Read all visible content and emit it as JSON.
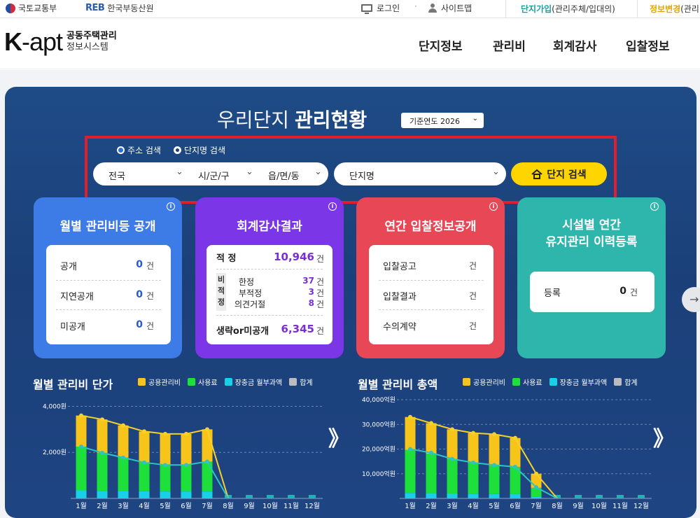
{
  "topbar": {
    "molit": "국토교통부",
    "reb_mark": "REB",
    "reb": "한국부동산원",
    "login": "로그인",
    "dot": "·",
    "sitemap": "사이트맵",
    "join_hl": "단지가입",
    "join_rest": "(관리주체/입대의)",
    "info_hl": "정보변경",
    "info_rest": "(관리"
  },
  "header": {
    "logo_k": "K",
    "logo_rest": "-apt",
    "logo_sub1": "공동주택관리",
    "logo_sub2": "정보시스템",
    "nav": [
      "단지정보",
      "관리비",
      "회계감사",
      "입찰정보"
    ]
  },
  "panel": {
    "title_light": "우리단지",
    "title_bold": "관리현황",
    "year_label": "기준연도 2026",
    "radio_address": "주소 검색",
    "radio_name": "단지명 검색",
    "sel_sido": "전국",
    "sel_sigungu": "시/군/구",
    "sel_emd": "읍/면/동",
    "sel_name": "단지명",
    "search_btn": "단지 검색"
  },
  "cards": {
    "c1": {
      "title": "월별 관리비등 공개",
      "rows": [
        {
          "label": "공개",
          "value": "0",
          "unit": "건"
        },
        {
          "label": "지연공개",
          "value": "0",
          "unit": "건"
        },
        {
          "label": "미공개",
          "value": "0",
          "unit": "건"
        }
      ]
    },
    "c2": {
      "title": "회계감사결과",
      "top_label": "적 정",
      "top_value": "10,946",
      "unit": "건",
      "box_chars": [
        "비",
        "적",
        "정"
      ],
      "subs": [
        {
          "label": "한정",
          "value": "37"
        },
        {
          "label": "부적정",
          "value": "3"
        },
        {
          "label": "의견거절",
          "value": "8"
        }
      ],
      "bottom_label": "생략or미공개",
      "bottom_value": "6,345"
    },
    "c3": {
      "title": "연간 입찰정보공개",
      "rows": [
        {
          "label": "입찰공고",
          "unit": "건"
        },
        {
          "label": "입찰결과",
          "unit": "건"
        },
        {
          "label": "수의계약",
          "unit": "건"
        }
      ]
    },
    "c4": {
      "title1": "시설별 연간",
      "title2": "유지관리 이력등록",
      "row_label": "등록",
      "row_value": "0",
      "row_unit": "건"
    },
    "info_glyph": "i",
    "arrow_glyph": "→"
  },
  "legend": [
    "공용관리비",
    "사용료",
    "장충금 월부과액",
    "합계"
  ],
  "colors": {
    "common": "#f7c51a",
    "usage": "#1ee03a",
    "ltr": "#18d0e8",
    "total": "#bcbcbc",
    "line_total": "#f5d12a",
    "line_common": "#2ec4c4"
  },
  "next_glyph": "》",
  "chart_data": [
    {
      "type": "bar",
      "title": "월별 관리비 단가",
      "categories": [
        "1월",
        "2월",
        "3월",
        "4월",
        "5월",
        "6월",
        "7월",
        "8월",
        "9월",
        "10월",
        "11월",
        "12월"
      ],
      "y_ticks": [
        "4,000원",
        "2,000원"
      ],
      "ylim": [
        0,
        4500
      ],
      "stacked": true,
      "series": [
        {
          "name": "장충금 월부과액",
          "values": [
            350,
            330,
            320,
            310,
            300,
            300,
            300,
            0,
            0,
            0,
            0,
            0
          ]
        },
        {
          "name": "사용료",
          "values": [
            1900,
            1650,
            1450,
            1250,
            1150,
            1150,
            1300,
            0,
            0,
            0,
            0,
            0
          ]
        },
        {
          "name": "공용관리비",
          "values": [
            1350,
            1450,
            1400,
            1350,
            1350,
            1350,
            1400,
            0,
            0,
            0,
            0,
            0
          ]
        }
      ],
      "lines": [
        {
          "name": "합계",
          "values": [
            3600,
            3430,
            3170,
            2910,
            2800,
            2800,
            3000,
            0,
            0,
            0,
            0,
            0
          ]
        },
        {
          "name": "공용관리비",
          "values": [
            2250,
            1980,
            1770,
            1560,
            1450,
            1450,
            1600,
            0,
            0,
            0,
            0,
            0
          ]
        }
      ],
      "grid": true
    },
    {
      "type": "bar",
      "title": "월별 관리비 총액",
      "categories": [
        "1월",
        "2월",
        "3월",
        "4월",
        "5월",
        "6월",
        "7월",
        "8월",
        "9월",
        "10월",
        "11월",
        "12월"
      ],
      "y_ticks": [
        "40,000억원",
        "30,000억원",
        "20,000억원",
        "10,000억원"
      ],
      "ylim": [
        0,
        42000
      ],
      "stacked": true,
      "series": [
        {
          "name": "장충금 월부과액",
          "values": [
            2200,
            2100,
            2000,
            1900,
            1800,
            1800,
            800,
            0,
            0,
            0,
            0,
            0
          ]
        },
        {
          "name": "사용료",
          "values": [
            17500,
            16000,
            14000,
            12500,
            11500,
            11000,
            3500,
            0,
            0,
            0,
            0,
            0
          ]
        },
        {
          "name": "공용관리비",
          "values": [
            13300,
            12400,
            12000,
            12100,
            12700,
            11700,
            5700,
            0,
            0,
            0,
            0,
            0
          ]
        }
      ],
      "lines": [
        {
          "name": "합계",
          "values": [
            33000,
            30500,
            28000,
            26500,
            26000,
            24500,
            10000,
            0,
            0,
            0,
            0,
            0
          ]
        },
        {
          "name": "공용관리비",
          "values": [
            20000,
            18500,
            16000,
            14500,
            13500,
            12800,
            4500,
            0,
            0,
            0,
            0,
            0
          ]
        }
      ],
      "grid": true
    }
  ]
}
